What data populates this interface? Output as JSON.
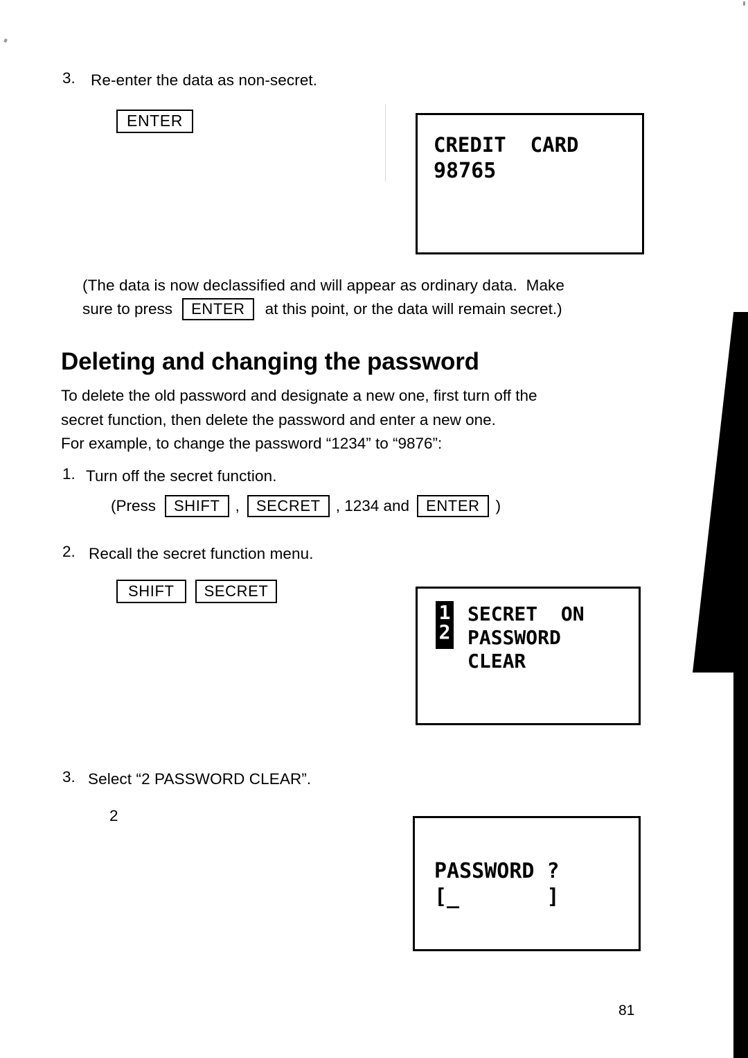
{
  "page": {
    "number": "81"
  },
  "step3_top": {
    "marker": "3.",
    "text": "Re-enter the data as non-secret.",
    "key": "ENTER"
  },
  "display1": {
    "line1": "CREDIT  CARD",
    "line2": "98765"
  },
  "note": {
    "line1": "(The data is now declassified and will appear as ordinary data.  Make",
    "line2_before": "sure to press",
    "line2_key": "ENTER",
    "line2_after": "at this point, or the data will remain secret.)"
  },
  "heading": "Deleting and changing the password",
  "intro": "To delete the old password and designate a new one, first turn off the\nsecret function, then delete the password and enter a new one.\nFor example, to change the password “1234” to “9876”:",
  "step1": {
    "marker": "1.",
    "text": "Turn off the secret function.",
    "press_open": "(Press",
    "key1": "SHIFT",
    "sep1": ",",
    "key2": "SECRET",
    "sep2": ", 1234 and",
    "key3": "ENTER",
    "press_close": ")"
  },
  "step2": {
    "marker": "2.",
    "text": "Recall the secret function menu.",
    "key1": "SHIFT",
    "key2": "SECRET"
  },
  "display2": {
    "inverse_digits": "1\n2",
    "line1": "SECRET  ON",
    "line2": "PASSWORD",
    "line3": "CLEAR"
  },
  "step3": {
    "marker": "3.",
    "text": "Select “2 PASSWORD CLEAR”.",
    "input": "2"
  },
  "display3": {
    "line1": "PASSWORD ?",
    "line2": "[_       ]"
  },
  "colors": {
    "ink": "#000000",
    "paper": "#ffffff"
  }
}
